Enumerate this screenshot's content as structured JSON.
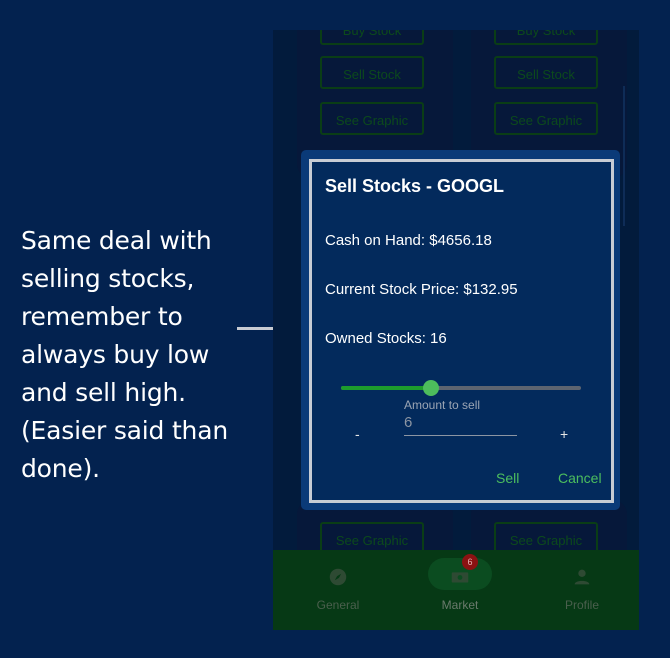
{
  "caption": {
    "text": "Same deal with selling stocks, remember to always buy low and sell high. (Easier said than done)."
  },
  "background_cards": {
    "buy_label": "Buy Stock",
    "sell_label": "Sell Stock",
    "graphic_label": "See Graphic"
  },
  "dialog": {
    "title": "Sell Stocks - GOOGL",
    "cash_on_hand": "Cash on Hand: $4656.18",
    "current_price": "Current Stock Price: $132.95",
    "owned": "Owned Stocks: 16",
    "slider": {
      "min": 0,
      "max": 16,
      "value": 6
    },
    "amount_label": "Amount to sell",
    "amount_value": "6",
    "decrement": "-",
    "increment": "+",
    "sell": "Sell",
    "cancel": "Cancel"
  },
  "bottom_nav": {
    "items": [
      {
        "label": "General",
        "icon": "compass-icon"
      },
      {
        "label": "Market",
        "icon": "cash-icon",
        "badge": "6"
      },
      {
        "label": "Profile",
        "icon": "person-icon"
      }
    ]
  },
  "colors": {
    "page_bg": "#03224f",
    "dialog_bg": "#032a5c",
    "accent_green": "#4cbe5e",
    "nav_bg": "#063915"
  }
}
